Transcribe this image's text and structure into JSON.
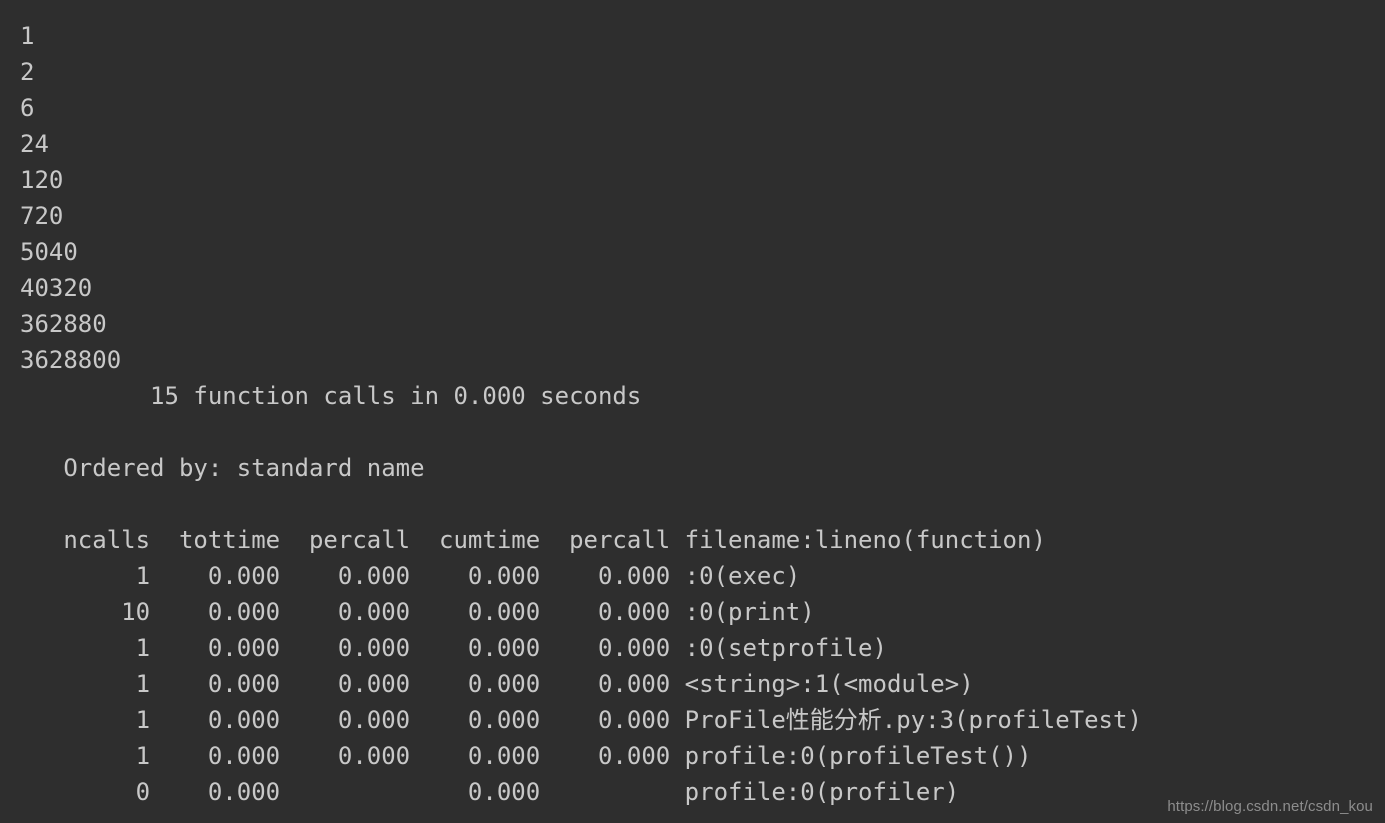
{
  "terminal": {
    "background_color": "#2e2e2e",
    "text_color": "#c8c8c8",
    "watermark_color": "#8d8d8d",
    "program_output": {
      "description": "factorial sequence printed by profileTest",
      "lines": [
        "1",
        "2",
        "6",
        "24",
        "120",
        "720",
        "5040",
        "40320",
        "362880",
        "3628800"
      ]
    },
    "profile_report": {
      "summary": "         15 function calls in 0.000 seconds",
      "summary_calls": "15",
      "summary_seconds": "0.000",
      "blank_1": "",
      "ordered_by": "   Ordered by: standard name",
      "ordered_by_value": "standard name",
      "blank_2": "",
      "header": "   ncalls  tottime  percall  cumtime  percall filename:lineno(function)",
      "columns": [
        "ncalls",
        "tottime",
        "percall",
        "cumtime",
        "percall",
        "filename:lineno(function)"
      ],
      "rows": [
        {
          "line": "        1    0.000    0.000    0.000    0.000 :0(exec)",
          "ncalls": "1",
          "tottime": "0.000",
          "percall": "0.000",
          "cumtime": "0.000",
          "percall2": "0.000",
          "function": ":0(exec)"
        },
        {
          "line": "       10    0.000    0.000    0.000    0.000 :0(print)",
          "ncalls": "10",
          "tottime": "0.000",
          "percall": "0.000",
          "cumtime": "0.000",
          "percall2": "0.000",
          "function": ":0(print)"
        },
        {
          "line": "        1    0.000    0.000    0.000    0.000 :0(setprofile)",
          "ncalls": "1",
          "tottime": "0.000",
          "percall": "0.000",
          "cumtime": "0.000",
          "percall2": "0.000",
          "function": ":0(setprofile)"
        },
        {
          "line": "        1    0.000    0.000    0.000    0.000 <string>:1(<module>)",
          "ncalls": "1",
          "tottime": "0.000",
          "percall": "0.000",
          "cumtime": "0.000",
          "percall2": "0.000",
          "function": "<string>:1(<module>)"
        },
        {
          "line": "        1    0.000    0.000    0.000    0.000 ProFile性能分析.py:3(profileTest)",
          "ncalls": "1",
          "tottime": "0.000",
          "percall": "0.000",
          "cumtime": "0.000",
          "percall2": "0.000",
          "function": "ProFile性能分析.py:3(profileTest)"
        },
        {
          "line": "        1    0.000    0.000    0.000    0.000 profile:0(profileTest())",
          "ncalls": "1",
          "tottime": "0.000",
          "percall": "0.000",
          "cumtime": "0.000",
          "percall2": "0.000",
          "function": "profile:0(profileTest())"
        },
        {
          "line": "        0    0.000             0.000          profile:0(profiler)",
          "ncalls": "0",
          "tottime": "0.000",
          "percall": "",
          "cumtime": "0.000",
          "percall2": "",
          "function": "profile:0(profiler)"
        }
      ]
    },
    "watermark": "https://blog.csdn.net/csdn_kou"
  }
}
